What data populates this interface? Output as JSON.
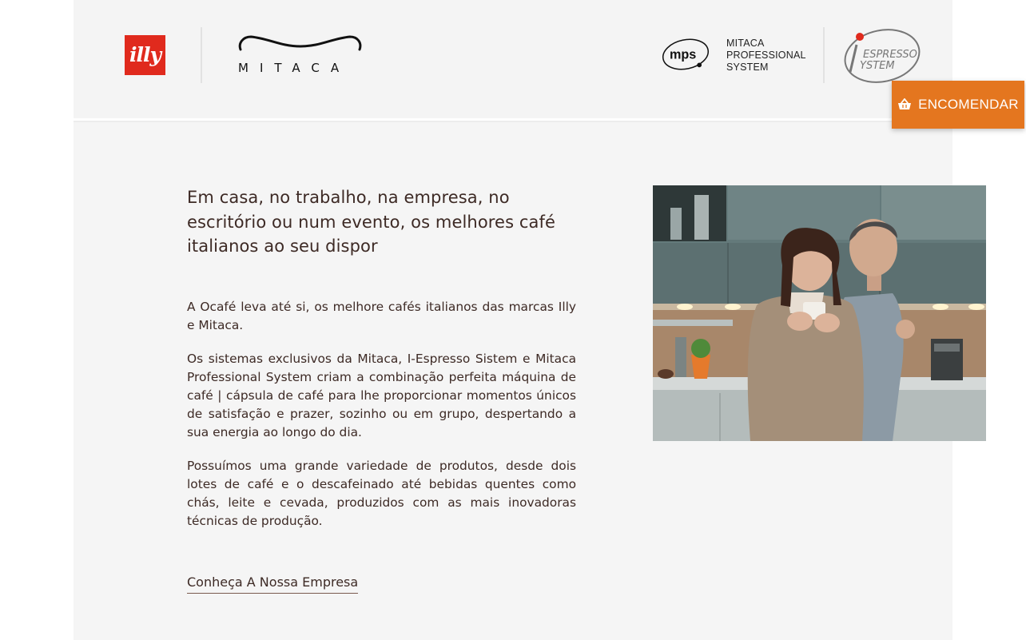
{
  "header": {
    "brand_logos": [
      {
        "name": "illy",
        "text": "illy"
      },
      {
        "name": "mitaca",
        "text": "MITACA"
      },
      {
        "name": "mps",
        "badge": "mps",
        "caption": "MITACA\nPROFESSIONAL\nSYSTEM"
      },
      {
        "name": "i-espresso-system",
        "line1": "ESPRESSO",
        "line2": "YSTEM"
      }
    ],
    "order_button": {
      "label": "ENCOMENDAR",
      "icon": "basket-icon",
      "color": "#e4761f"
    }
  },
  "main": {
    "headline": "Em casa, no trabalho, na empresa, no escritório ou num evento, os melhores café italianos ao seu dispor",
    "paragraphs": [
      "A Ocafé leva até si, os melhore cafés italianos das marcas Illy e Mitaca.",
      "Os sistemas exclusivos da Mitaca, I-Espresso Sistem e Mitaca Professional System criam a combinação perfeita máquina de café | cápsula de café para lhe proporcionar momentos únicos de satisfação e prazer, sozinho ou em grupo, despertando a sua energia ao longo do dia.",
      "Possuímos uma grande variedade de produtos, desde dois lotes de café e o descafeinado até bebidas quentes como chás, leite e cevada, produzidos com as mais inovadoras técnicas de produção."
    ],
    "company_link": "Conheça A Nossa Empresa",
    "photo": {
      "subject": "couple-drinking-coffee-in-kitchen-photo"
    }
  },
  "colors": {
    "accent": "#e4761f",
    "illy_red": "#e02a1d",
    "text": "#3d2a25",
    "background": "#f5f5f5"
  }
}
